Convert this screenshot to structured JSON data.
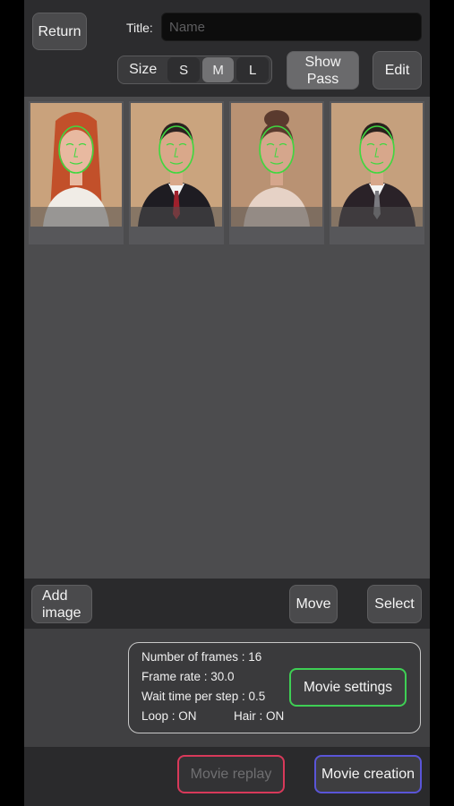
{
  "header": {
    "return_label": "Return",
    "title_label": "Title:",
    "title_placeholder": "Name",
    "title_value": "",
    "size_label": "Size",
    "size_options": [
      "S",
      "M",
      "L"
    ],
    "size_selected": "M",
    "show_pass_label": [
      "Show",
      "Pass"
    ],
    "edit_label": "Edit"
  },
  "gallery": {
    "items": [
      {
        "subject": "woman-red-hair",
        "bg": "#c9a27c",
        "skin": "#e8b9a0",
        "hair": "#c2502a",
        "cloth": "#f0ece6"
      },
      {
        "subject": "man-dark-suit",
        "bg": "#caa47e",
        "skin": "#d9a88a",
        "hair": "#2b2220",
        "cloth": "#1e1c22"
      },
      {
        "subject": "woman-updo",
        "bg": "#b99273",
        "skin": "#d5a68c",
        "hair": "#5a3a2e",
        "cloth": "#e6d2c6"
      },
      {
        "subject": "man-suit-tie",
        "bg": "#c5a07d",
        "skin": "#d7a78b",
        "hair": "#2a211d",
        "cloth": "#2a2228"
      }
    ],
    "overlay_color": "#3fd83f"
  },
  "toolbar": {
    "add_image_label": [
      "Add",
      "image"
    ],
    "move_label": "Move",
    "select_label": "Select"
  },
  "settings": {
    "frames": "Number of frames : 16",
    "frame_rate": "Frame rate : 30.0",
    "wait_time": "Wait time per step : 0.5",
    "loop": "Loop : ON",
    "hair": "Hair : ON",
    "movie_settings_label": "Movie settings"
  },
  "bottom": {
    "replay_label": "Movie replay",
    "creation_label": "Movie creation"
  },
  "colors": {
    "settings_accent": "#3ecf54",
    "replay_accent": "#d8395a",
    "creation_accent": "#5a55d8"
  }
}
